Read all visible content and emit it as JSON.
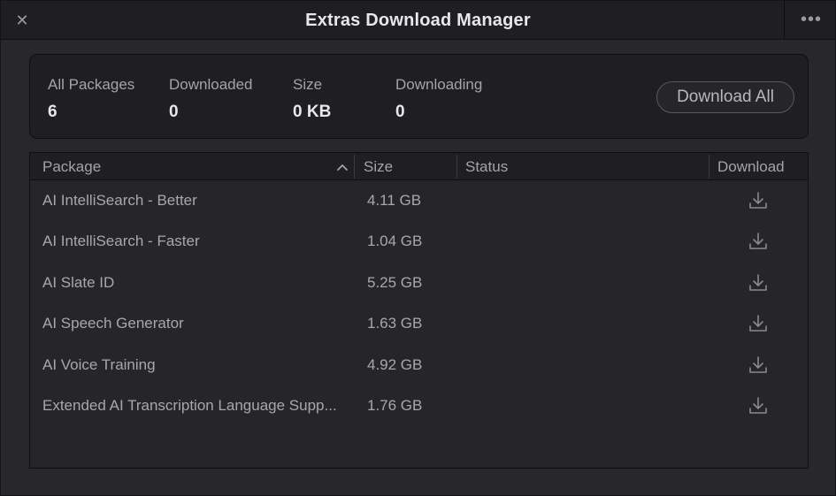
{
  "window": {
    "title": "Extras Download Manager",
    "close_symbol": "✕",
    "menu_symbol": "•••"
  },
  "summary": {
    "stats": [
      {
        "label": "All Packages",
        "value": "6"
      },
      {
        "label": "Downloaded",
        "value": "0"
      },
      {
        "label": "Size",
        "value": "0 KB"
      },
      {
        "label": "Downloading",
        "value": "0"
      }
    ],
    "download_all_label": "Download All"
  },
  "table": {
    "columns": {
      "package": "Package",
      "size": "Size",
      "status": "Status",
      "download": "Download"
    },
    "sort": {
      "column": "Package",
      "direction": "ascending"
    },
    "rows": [
      {
        "name": "AI IntelliSearch - Better",
        "size": "4.11 GB",
        "status": ""
      },
      {
        "name": "AI IntelliSearch - Faster",
        "size": "1.04 GB",
        "status": ""
      },
      {
        "name": "AI Slate ID",
        "size": "5.25 GB",
        "status": ""
      },
      {
        "name": "AI Speech Generator",
        "size": "1.63 GB",
        "status": ""
      },
      {
        "name": "AI Voice Training",
        "size": "4.92 GB",
        "status": ""
      },
      {
        "name": "Extended AI Transcription Language Supp...",
        "size": "1.76 GB",
        "status": ""
      }
    ]
  },
  "icons": {
    "close": "close-icon",
    "menu": "more-horizontal-icon",
    "sort": "chevron-up-icon",
    "download": "download-icon"
  },
  "colors": {
    "background": "#28282c",
    "panel": "#1f1f23",
    "text_primary": "#e8e8ea",
    "text_secondary": "#a4a4a8"
  }
}
